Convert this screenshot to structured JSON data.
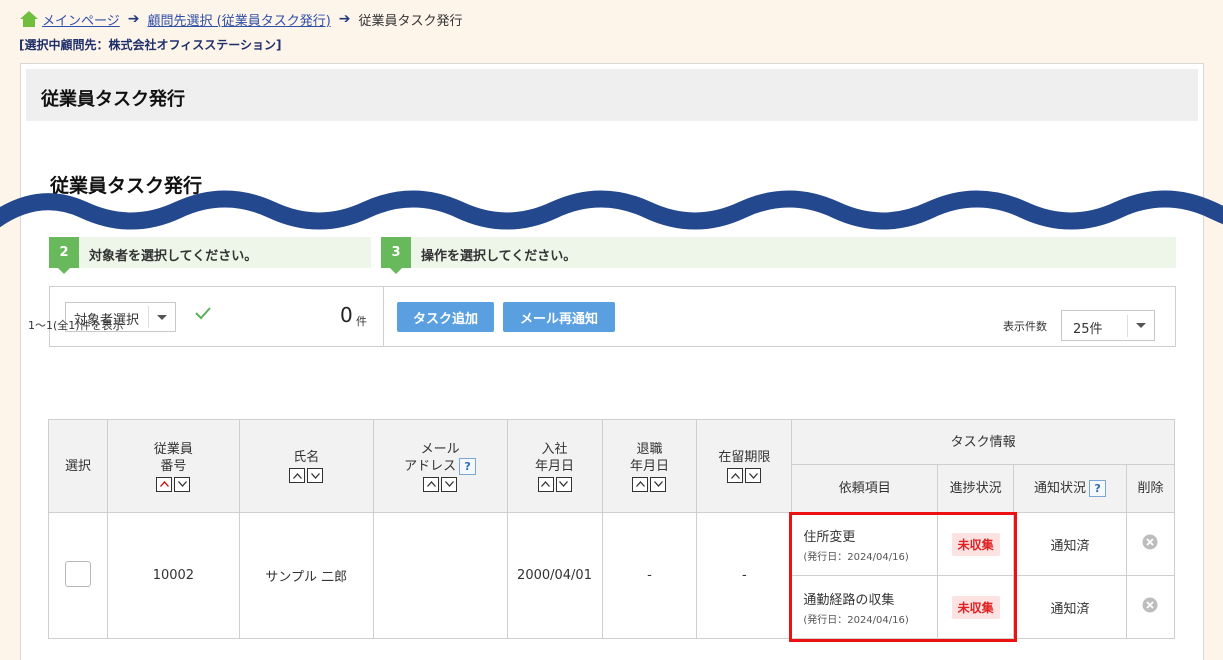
{
  "breadcrumb": {
    "home": "メインページ",
    "level2": "顧問先選択 (従業員タスク発行)",
    "current": "従業員タスク発行"
  },
  "client_info": "[選択中顧問先：株式会社オフィスステーション]",
  "panel": {
    "title": "従業員タスク発行",
    "section_title": "従業員タスク発行"
  },
  "steps": [
    {
      "num": "2",
      "label": "対象者を選択してください。"
    },
    {
      "num": "3",
      "label": "操作を選択してください。"
    }
  ],
  "operations": {
    "target_select": "対象者選択",
    "count": "0",
    "count_unit": "件",
    "add_task": "タスク追加",
    "resend_mail": "メール再通知"
  },
  "list": {
    "showing": "1～1(全1)件を表示",
    "perpage_label": "表示件数",
    "perpage_value": "25件"
  },
  "table": {
    "headers": {
      "select": "選択",
      "emp_no_1": "従業員",
      "emp_no_2": "番号",
      "name": "氏名",
      "mail_1": "メール",
      "mail_2": "アドレス",
      "join_1": "入社",
      "join_2": "年月日",
      "retire_1": "退職",
      "retire_2": "年月日",
      "residence": "在留期限",
      "task_info": "タスク情報",
      "request": "依頼項目",
      "progress": "進捗状況",
      "notify": "通知状況",
      "delete": "削除"
    },
    "rows": [
      {
        "emp_no": "10002",
        "name": "サンプル 二郎",
        "mail": "",
        "join_date": "2000/04/01",
        "retire_date": "-",
        "residence": "-",
        "tasks": [
          {
            "item": "住所変更",
            "issued": "(発行日：2024/04/16)",
            "status": "未収集",
            "notify": "通知済"
          },
          {
            "item": "通勤経路の収集",
            "issued": "(発行日：2024/04/16)",
            "status": "未収集",
            "notify": "通知済"
          }
        ]
      }
    ]
  },
  "colors": {
    "wave": "#23488d",
    "highlight": "#ee1111",
    "button": "#5a9fe0",
    "step": "#67b95b",
    "badge_text": "#e02020"
  }
}
